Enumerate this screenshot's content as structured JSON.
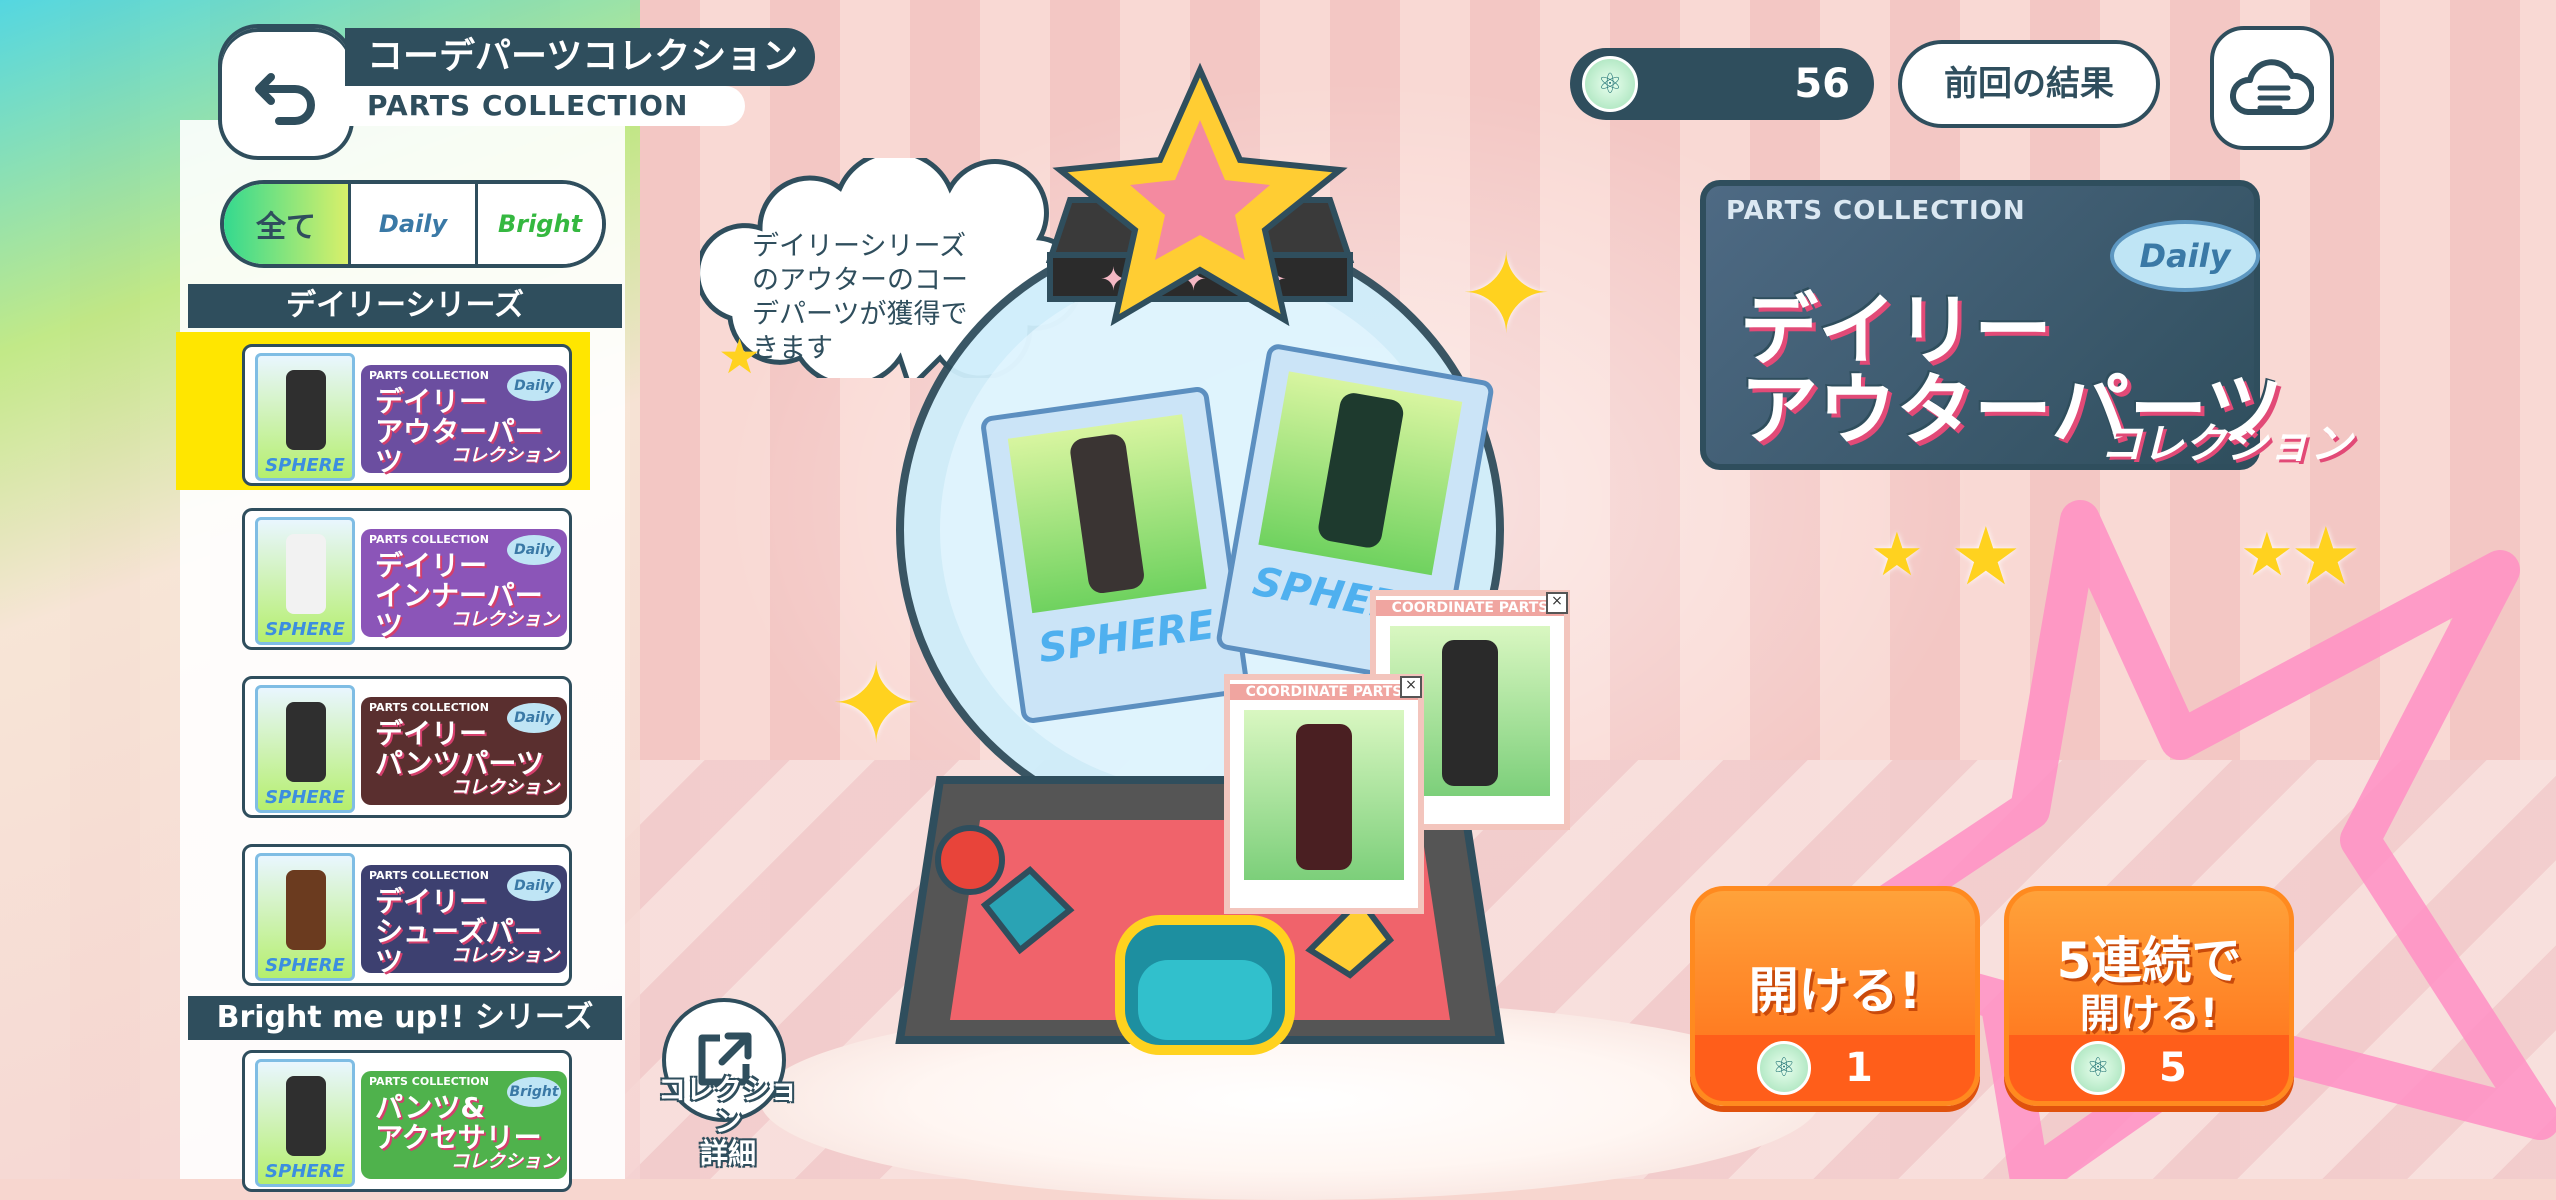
{
  "header": {
    "title_jp": "コーデパーツコレクション",
    "title_en": "PARTS COLLECTION"
  },
  "filter": {
    "all_label": "全て",
    "daily_label": "Daily",
    "bright_label": "Bright"
  },
  "sidebar": {
    "series": [
      {
        "heading": "デイリーシリーズ",
        "items": [
          {
            "name": "デイリー\nアウターパーツ",
            "sub": "コレクション",
            "badge": "Daily",
            "card": "SPHERE",
            "pc": "PARTS COLLECTION",
            "selected": true,
            "color": "#2f2f2f"
          },
          {
            "name": "デイリー\nインナーパーツ",
            "sub": "コレクション",
            "badge": "Daily",
            "card": "SPHERE",
            "pc": "PARTS COLLECTION",
            "selected": false,
            "color": "#f2f2f2"
          },
          {
            "name": "デイリー\nパンツパーツ",
            "sub": "コレクション",
            "badge": "Daily",
            "card": "SPHERE",
            "pc": "PARTS COLLECTION",
            "selected": false,
            "color": "#2f2f2f"
          },
          {
            "name": "デイリー\nシューズパーツ",
            "sub": "コレクション",
            "badge": "Daily",
            "card": "SPHERE",
            "pc": "PARTS COLLECTION",
            "selected": false,
            "color": "#6b3b1f"
          }
        ]
      },
      {
        "heading": "Bright me up!! シリーズ",
        "items": [
          {
            "name": "パンツ&\nアクセサリー",
            "sub": "コレクション",
            "badge": "Bright",
            "card": "SPHERE",
            "pc": "PARTS COLLECTION",
            "selected": false,
            "color": "#2f2f2f"
          }
        ]
      }
    ]
  },
  "currency": {
    "value": "56",
    "icon": "atom-gem-icon"
  },
  "prev_result_label": "前回の結果",
  "bubble_text": "デイリーシリーズ\nのアウターのコー\nデパーツが獲得で\nきます",
  "gacha": {
    "card_label": "SPHERE",
    "coord_label": "COORDINATE PARTS"
  },
  "banner": {
    "pc_label": "PARTS COLLECTION",
    "badge": "Daily",
    "name_line1": "デイリー",
    "name_line2": "アウターパーツ",
    "sub": "コレクション"
  },
  "open_single": {
    "label": "開ける!",
    "cost": "1"
  },
  "open_multi": {
    "label_line1": "5連続で",
    "label_line2": "開ける!",
    "cost": "5"
  },
  "collection_detail": {
    "label_line1": "コレクション",
    "label_line2": "詳細"
  },
  "colors": {
    "navy": "#2f4e5d",
    "orange": "#ff7a1f",
    "yellow": "#ffe600"
  }
}
